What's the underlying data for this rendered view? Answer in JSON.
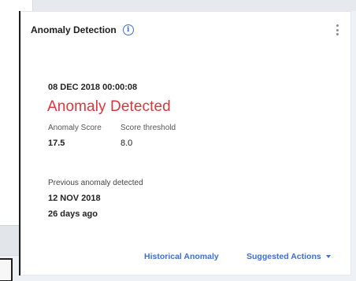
{
  "card": {
    "title": "Anomaly Detection",
    "info_icon": "info-icon",
    "menu_icon": "kebab-menu-icon",
    "timestamp": "08 DEC 2018 00:00:08",
    "status": "Anomaly Detected",
    "status_color": "#e0343d",
    "metrics": {
      "anomaly_score_label": "Anomaly Score",
      "anomaly_score_value": "17.5",
      "threshold_label": "Score threshold",
      "threshold_value": "8.0"
    },
    "previous": {
      "label": "Previous anomaly detected",
      "date": "12 NOV 2018",
      "ago": "26 days ago"
    },
    "footer": {
      "historical_label": "Historical Anomaly",
      "suggested_label": "Suggested Actions",
      "link_color": "#3b6fd6"
    }
  }
}
